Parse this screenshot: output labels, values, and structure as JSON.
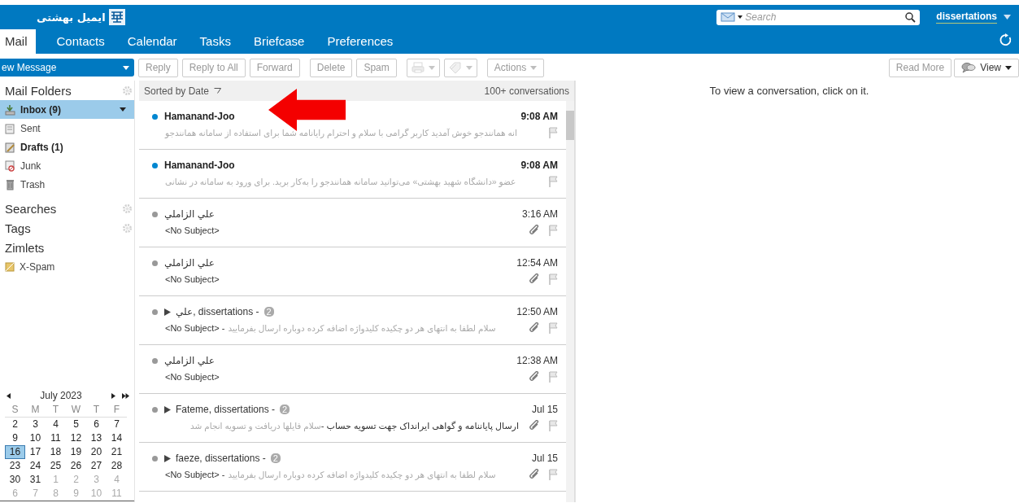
{
  "header": {
    "logo_text": "ایمیل بهشتی",
    "search": {
      "placeholder": "Search"
    },
    "user": "dissertations"
  },
  "tabs": [
    {
      "label": "Mail",
      "selected": true
    },
    {
      "label": "Contacts",
      "selected": false
    },
    {
      "label": "Calendar",
      "selected": false
    },
    {
      "label": "Tasks",
      "selected": false
    },
    {
      "label": "Briefcase",
      "selected": false
    },
    {
      "label": "Preferences",
      "selected": false
    }
  ],
  "toolbar": {
    "new_message": "ew Message",
    "button_groups": [
      [
        {
          "kind": "text",
          "label": "Reply",
          "disabled": true
        },
        {
          "kind": "text",
          "label": "Reply to All",
          "disabled": true
        },
        {
          "kind": "text",
          "label": "Forward",
          "disabled": true
        }
      ],
      [
        {
          "kind": "text",
          "label": "Delete",
          "disabled": true
        },
        {
          "kind": "text",
          "label": "Spam",
          "disabled": true
        }
      ],
      [
        {
          "kind": "print",
          "disabled": true
        },
        {
          "kind": "tag",
          "disabled": true
        }
      ],
      [
        {
          "kind": "menu",
          "label": "Actions",
          "disabled": true
        }
      ]
    ],
    "right_buttons": [
      {
        "kind": "text",
        "label": "Read More",
        "disabled": true
      },
      {
        "kind": "view",
        "label": "View",
        "disabled": false
      }
    ]
  },
  "sidebar": {
    "folders_title": "Mail Folders",
    "folders": [
      {
        "kind": "inbox",
        "label": "Inbox (9)",
        "unread": true,
        "selected": true
      },
      {
        "kind": "sent",
        "label": "Sent",
        "unread": false,
        "selected": false
      },
      {
        "kind": "drafts",
        "label": "Drafts (1)",
        "unread": true,
        "selected": false
      },
      {
        "kind": "junk",
        "label": "Junk",
        "unread": false,
        "selected": false
      },
      {
        "kind": "trash",
        "label": "Trash",
        "unread": false,
        "selected": false
      }
    ],
    "sections": [
      {
        "label": "Searches",
        "settings": true
      },
      {
        "label": "Tags",
        "settings": true
      },
      {
        "label": "Zimlets",
        "settings": false,
        "items": [
          {
            "label": "X-Spam"
          }
        ]
      }
    ],
    "calendar": {
      "month": "July 2023",
      "weekdays": [
        "S",
        "M",
        "T",
        "W",
        "T",
        "F"
      ],
      "weeks": [
        [
          {
            "day": "2",
            "selected": false,
            "other_month": false
          },
          {
            "day": "3",
            "selected": false,
            "other_month": false
          },
          {
            "day": "4",
            "selected": false,
            "other_month": false
          },
          {
            "day": "5",
            "selected": false,
            "other_month": false
          },
          {
            "day": "6",
            "selected": false,
            "other_month": false
          },
          {
            "day": "7",
            "selected": false,
            "other_month": false
          }
        ],
        [
          {
            "day": "9",
            "selected": false,
            "other_month": false
          },
          {
            "day": "10",
            "selected": false,
            "other_month": false
          },
          {
            "day": "11",
            "selected": false,
            "other_month": false
          },
          {
            "day": "12",
            "selected": false,
            "other_month": false
          },
          {
            "day": "13",
            "selected": false,
            "other_month": false
          },
          {
            "day": "14",
            "selected": false,
            "other_month": false
          }
        ],
        [
          {
            "day": "16",
            "selected": true,
            "other_month": false
          },
          {
            "day": "17",
            "selected": false,
            "other_month": false
          },
          {
            "day": "18",
            "selected": false,
            "other_month": false
          },
          {
            "day": "19",
            "selected": false,
            "other_month": false
          },
          {
            "day": "20",
            "selected": false,
            "other_month": false
          },
          {
            "day": "21",
            "selected": false,
            "other_month": false
          }
        ],
        [
          {
            "day": "23",
            "selected": false,
            "other_month": false
          },
          {
            "day": "24",
            "selected": false,
            "other_month": false
          },
          {
            "day": "25",
            "selected": false,
            "other_month": false
          },
          {
            "day": "26",
            "selected": false,
            "other_month": false
          },
          {
            "day": "27",
            "selected": false,
            "other_month": false
          },
          {
            "day": "28",
            "selected": false,
            "other_month": false
          }
        ],
        [
          {
            "day": "30",
            "selected": false,
            "other_month": false
          },
          {
            "day": "31",
            "selected": false,
            "other_month": false
          },
          {
            "day": "1",
            "selected": false,
            "other_month": true
          },
          {
            "day": "2",
            "selected": false,
            "other_month": true
          },
          {
            "day": "3",
            "selected": false,
            "other_month": true
          },
          {
            "day": "4",
            "selected": false,
            "other_month": true
          }
        ],
        [
          {
            "day": "6",
            "selected": false,
            "other_month": true
          },
          {
            "day": "7",
            "selected": false,
            "other_month": true
          },
          {
            "day": "8",
            "selected": false,
            "other_month": true
          },
          {
            "day": "9",
            "selected": false,
            "other_month": true
          },
          {
            "day": "10",
            "selected": false,
            "other_month": true
          },
          {
            "day": "11",
            "selected": false,
            "other_month": true
          }
        ]
      ]
    }
  },
  "list": {
    "sort_label": "Sorted by Date",
    "count": "100+ conversations",
    "conversations": [
      {
        "sender": "Hamanand-Joo",
        "unread": true,
        "expandable": false,
        "time": "9:08 AM",
        "fragment": "انه همانندجو خوش آمدید کاربر گرامی با سلام و احترام رایانامه شما برای استفاده از سامانه همانندجو",
        "attachment": false
      },
      {
        "sender": "Hamanand-Joo",
        "unread": true,
        "expandable": false,
        "time": "9:08 AM",
        "fragment": "عضو «دانشگاه شهید بهشتی» می‌توانید سامانه همانندجو را به‌کار برید. برای ورود به سامانه در نشانی",
        "attachment": false
      },
      {
        "sender": "علي الزاملي",
        "unread": false,
        "expandable": false,
        "time": "3:16 AM",
        "subject": "<No Subject>",
        "attachment": true
      },
      {
        "sender": "علي الزاملي",
        "unread": false,
        "expandable": false,
        "time": "12:54 AM",
        "subject": "<No Subject>",
        "attachment": true
      },
      {
        "sender": "علي, dissertations -",
        "unread": false,
        "expandable": true,
        "count": "2",
        "time": "12:50 AM",
        "subject": "<No Subject> -",
        "fragment": "سلام لطفا به انتهای هر دو چکیده کلیدواژه اضافه کرده دوباره ارسال بفرمایید",
        "attachment": true
      },
      {
        "sender": "علي الزاملي",
        "unread": false,
        "expandable": false,
        "time": "12:38 AM",
        "subject": "<No Subject>",
        "attachment": true
      },
      {
        "sender": "Fateme, dissertations -",
        "unread": false,
        "expandable": true,
        "count": "2",
        "time": "Jul 15",
        "subject": "ارسال پایاننامه و گواهی ایرانداک جهت تسویه حساب -",
        "fragment": "سلام فایلها دریافت و تسویه انجام شد",
        "attachment": true
      },
      {
        "sender": "faeze, dissertations -",
        "unread": false,
        "expandable": true,
        "count": "2",
        "time": "Jul 15",
        "subject": "<No Subject> -",
        "fragment": "سلام لطفا به انتهای هر دو چکیده کلیدواژه اضافه کرده دوباره ارسال بفرمایید",
        "attachment": true
      }
    ]
  },
  "reading_pane": {
    "hint": "To view a conversation, click on it."
  }
}
